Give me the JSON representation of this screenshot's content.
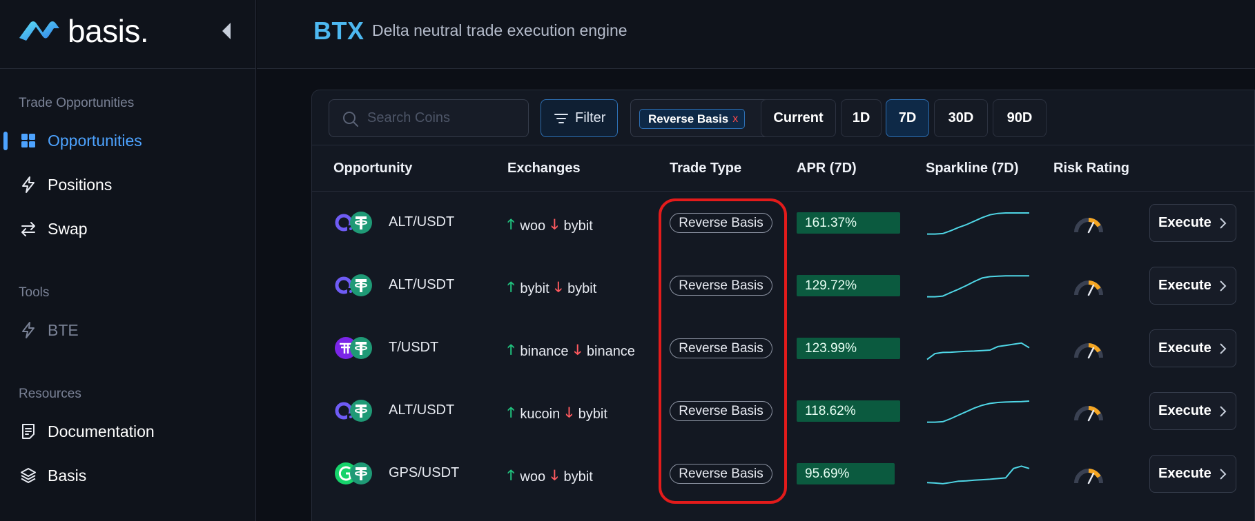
{
  "sidebar": {
    "logo_text": "basis.",
    "sections": {
      "trade": "Trade Opportunities",
      "tools": "Tools",
      "resources": "Resources"
    },
    "items": {
      "opportunities": "Opportunities",
      "positions": "Positions",
      "swap": "Swap",
      "bte": "BTE",
      "documentation": "Documentation",
      "basis": "Basis"
    }
  },
  "header": {
    "brand": "BTX",
    "tagline": "Delta neutral trade execution engine"
  },
  "toolbar": {
    "search_placeholder": "Search Coins",
    "filter_label": "Filter",
    "selected_trade_type": "Reverse Basis",
    "chip_remove": "x",
    "periods": [
      "Current",
      "1D",
      "7D",
      "30D",
      "90D"
    ],
    "active_period": "7D"
  },
  "table": {
    "headers": {
      "opportunity": "Opportunity",
      "exchanges": "Exchanges",
      "trade_type": "Trade Type",
      "apr": "APR (7D)",
      "sparkline": "Sparkline (7D)",
      "risk": "Risk Rating"
    },
    "execute_label": "Execute",
    "rows": [
      {
        "pair": "ALT/USDT",
        "long": "woo",
        "short": "bybit",
        "trade_type": "Reverse Basis",
        "apr": "161.37%",
        "coin_icon": "alt-icon",
        "spark": [
          1,
          1,
          1.2,
          2.4,
          3.8,
          5,
          6.5,
          8,
          9.2,
          9.8,
          10,
          10,
          10,
          10
        ]
      },
      {
        "pair": "ALT/USDT",
        "long": "bybit",
        "short": "bybit",
        "trade_type": "Reverse Basis",
        "apr": "129.72%",
        "coin_icon": "alt-icon",
        "spark": [
          1,
          1,
          1.3,
          2.8,
          4.2,
          5.8,
          7.5,
          9,
          9.6,
          9.8,
          9.9,
          9.9,
          9.9,
          9.9
        ]
      },
      {
        "pair": "T/USDT",
        "long": "binance",
        "short": "binance",
        "trade_type": "Reverse Basis",
        "apr": "123.99%",
        "coin_icon": "t-icon",
        "spark": [
          1,
          3.5,
          4,
          4.1,
          4.3,
          4.5,
          4.6,
          4.8,
          5,
          6.5,
          7,
          7.5,
          8,
          6
        ]
      },
      {
        "pair": "ALT/USDT",
        "long": "kucoin",
        "short": "bybit",
        "trade_type": "Reverse Basis",
        "apr": "118.62%",
        "coin_icon": "alt-icon",
        "spark": [
          1,
          1,
          1.2,
          2.5,
          4,
          5.5,
          7,
          8.2,
          9,
          9.4,
          9.6,
          9.7,
          9.8,
          10
        ]
      },
      {
        "pair": "GPS/USDT",
        "long": "woo",
        "short": "bybit",
        "trade_type": "Reverse Basis",
        "apr": "95.69%",
        "coin_icon": "gps-icon",
        "spark": [
          2,
          1.8,
          1.5,
          2,
          2.6,
          2.7,
          3,
          3.2,
          3.4,
          3.7,
          4,
          8,
          9,
          8
        ]
      }
    ]
  },
  "colors": {
    "accent": "#4da3ff",
    "brand": "#4db8f0",
    "apr_bg": "#0b5a3f",
    "spark": "#4fd6e6",
    "highlight": "#e31b1b"
  }
}
